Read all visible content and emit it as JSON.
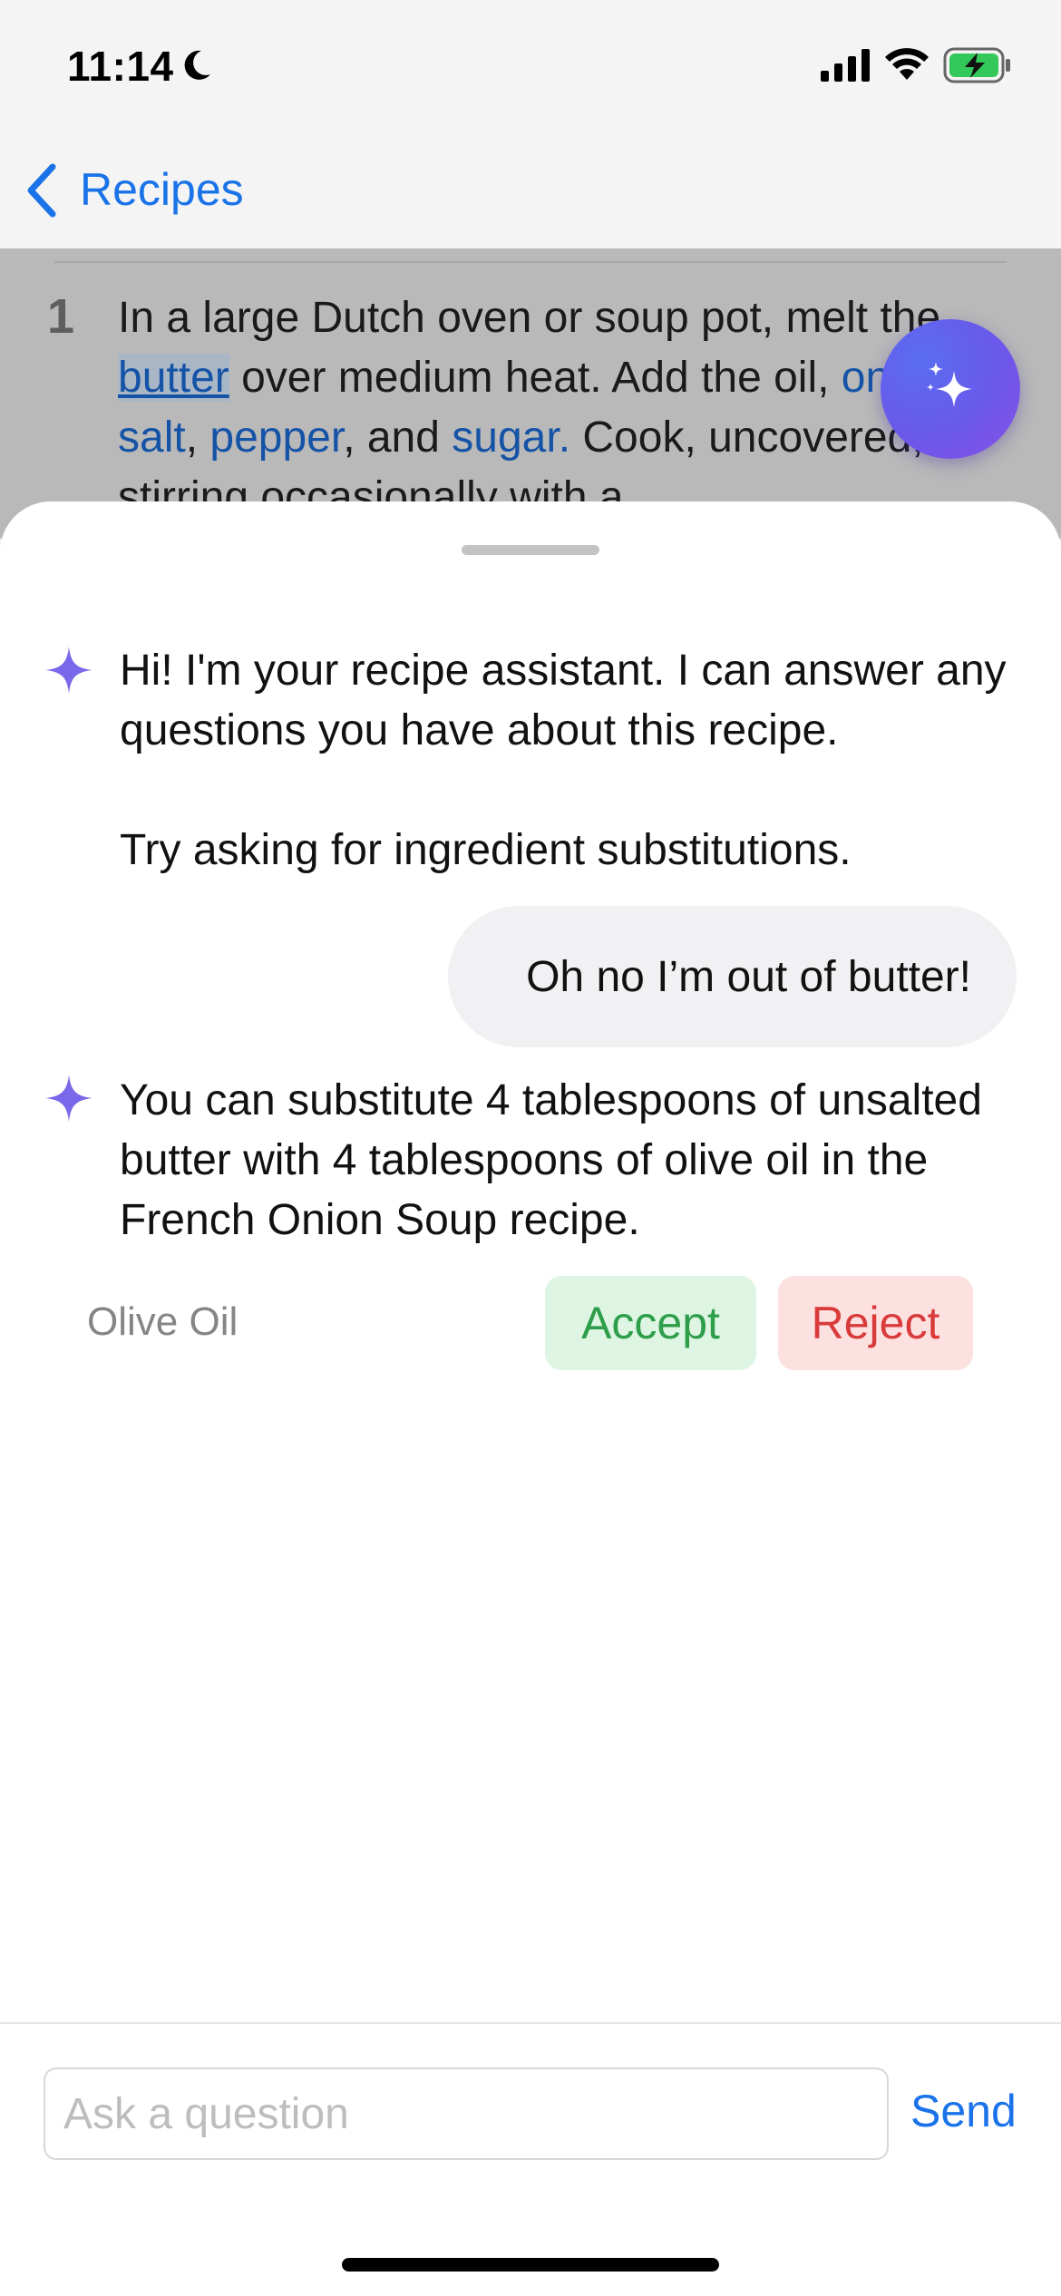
{
  "status_bar": {
    "time": "11:14"
  },
  "nav": {
    "back_label": "Recipes"
  },
  "recipe_step": {
    "number": "1",
    "text_parts": [
      {
        "t": "In a large Dutch oven or soup pot, melt the ",
        "kind": "plain"
      },
      {
        "t": "butter",
        "kind": "highlight"
      },
      {
        "t": " over medium heat. Add the oil, ",
        "kind": "plain"
      },
      {
        "t": "onions",
        "kind": "ingredient"
      },
      {
        "t": ", ",
        "kind": "plain"
      },
      {
        "t": "salt",
        "kind": "ingredient"
      },
      {
        "t": ", ",
        "kind": "plain"
      },
      {
        "t": "pepper",
        "kind": "ingredient"
      },
      {
        "t": ", and ",
        "kind": "plain"
      },
      {
        "t": "sugar.",
        "kind": "ingredient"
      },
      {
        "t": " Cook, uncovered, stirring occasionally with a",
        "kind": "plain"
      }
    ]
  },
  "chat": {
    "assistant_intro_1": "Hi! I'm your recipe assistant. I can answer any questions you have about this recipe.",
    "assistant_intro_2": "Try asking for ingredient substitutions.",
    "user_message": "Oh no I’m out of butter!",
    "assistant_reply": "You can substitute 4 tablespoons of unsalted butter with 4 tablespoons of olive oil in the French Onion Soup recipe.",
    "substitution_label": "Olive Oil",
    "accept_label": "Accept",
    "reject_label": "Reject"
  },
  "input": {
    "placeholder": "Ask a question",
    "value": "",
    "send_label": "Send"
  },
  "colors": {
    "accent": "#1a73e8",
    "assistant_icon": "#7a68ea",
    "accept_bg": "#dff5e3",
    "accept_text": "#2e9e4a",
    "reject_bg": "#fde1e1",
    "reject_text": "#d93a3a"
  },
  "icons": {
    "back": "chevron-left-icon",
    "assistant": "sparkle-icon",
    "fab": "sparkles-icon"
  }
}
